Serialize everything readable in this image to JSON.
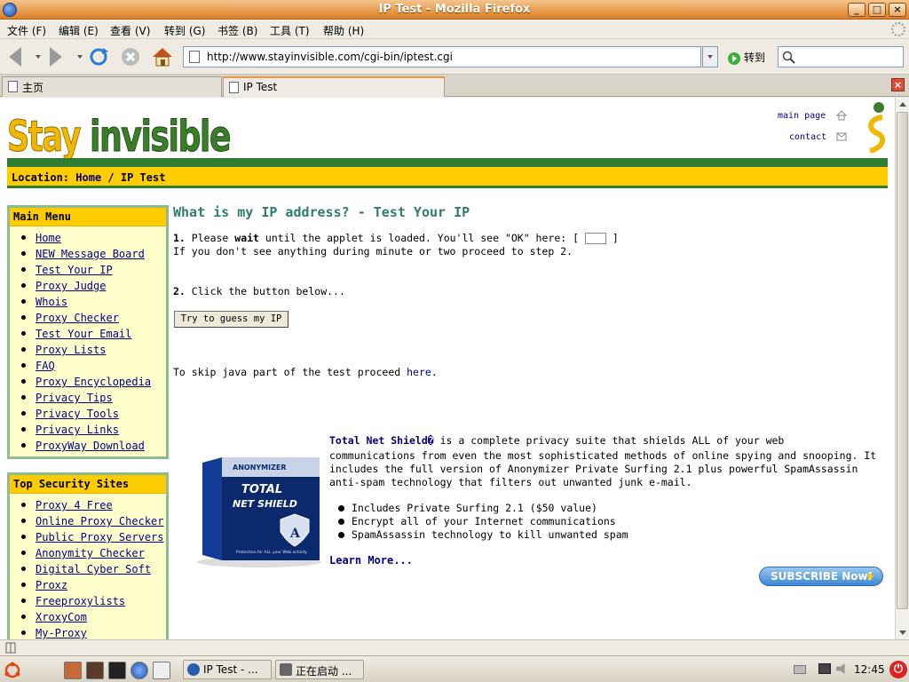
{
  "window": {
    "title": "IP Test - Mozilla Firefox",
    "buttons": [
      "_",
      "□",
      "×"
    ]
  },
  "menu": [
    "文件 (F)",
    "编辑 (E)",
    "查看 (V)",
    "转到 (G)",
    "书签 (B)",
    "工具 (T)",
    "帮助 (H)"
  ],
  "nav": {
    "url": "http://www.stayinvisible.com/cgi-bin/iptest.cgi",
    "go_label": "转到",
    "search_value": ""
  },
  "tabs": [
    {
      "label": "主页",
      "active": false
    },
    {
      "label": "IP Test",
      "active": true
    }
  ],
  "page": {
    "logo_text": "Stay invisible",
    "top_links": {
      "main_page": "main page",
      "contact": "contact"
    },
    "location": {
      "label": "Location:",
      "home": "Home",
      "sep": "/",
      "current": "IP Test"
    },
    "main_menu": {
      "title": "Main Menu",
      "items": [
        "Home",
        "NEW Message Board",
        "Test Your IP",
        "Proxy Judge",
        "Whois",
        "Proxy Checker",
        "Test Your Email",
        "Proxy Lists",
        "FAQ",
        "Proxy Encyclopedia",
        "Privacy Tips",
        "Privacy Tools",
        "Privacy Links",
        "ProxyWay Download"
      ]
    },
    "security_sites": {
      "title": "Top Security Sites",
      "items": [
        "Proxy 4 Free",
        "Online Proxy Checker",
        "Public Proxy Servers",
        "Anonymity Checker",
        "Digital Cyber Soft",
        "Proxz",
        "Freeproxylists",
        "XroxyCom",
        "My-Proxy"
      ]
    },
    "heading": "What is my IP address? - Test Your IP",
    "step1": {
      "num": "1.",
      "pre": "Please",
      "bold": "wait",
      "post": "until the applet is loaded. You'll see \"OK\" here: [",
      "close": "]",
      "line2": "If you don't see anything during minute or two proceed to step 2."
    },
    "step2": {
      "num": "2.",
      "text": "Click the button below..."
    },
    "guess_button": "Try to guess my IP",
    "skip": {
      "pre": "To skip java part of the test proceed",
      "link": "here",
      "post": "."
    },
    "promo": {
      "product": "Total Net Shield�",
      "desc1": " is a complete privacy suite that shields ALL of your web",
      "desc2": "communications from even the most sophisticated methods of online spying and snooping. It",
      "desc3": "includes the full version of Anonymizer Private Surfing 2.1 plus powerful SpamAssassin",
      "desc4": "anti-spam technology that filters out unwanted junk e-mail.",
      "bullets": [
        "Includes Private Surfing 2.1 ($50 value)",
        "Encrypt all of your Internet communications",
        "SpamAssassin technology to kill unwanted spam"
      ],
      "learn_more": "Learn More...",
      "subscribe": "SUBSCRIBE Now!",
      "box_brand": "ANONYMIZER",
      "box_title1": "TOTAL",
      "box_title2": "NET SHIELD",
      "box_tag": "Protection for ALL your Web activity"
    }
  },
  "taskbar": {
    "items": [
      "IP Test - ...",
      "正在启动 ..."
    ],
    "clock": "12:45"
  }
}
